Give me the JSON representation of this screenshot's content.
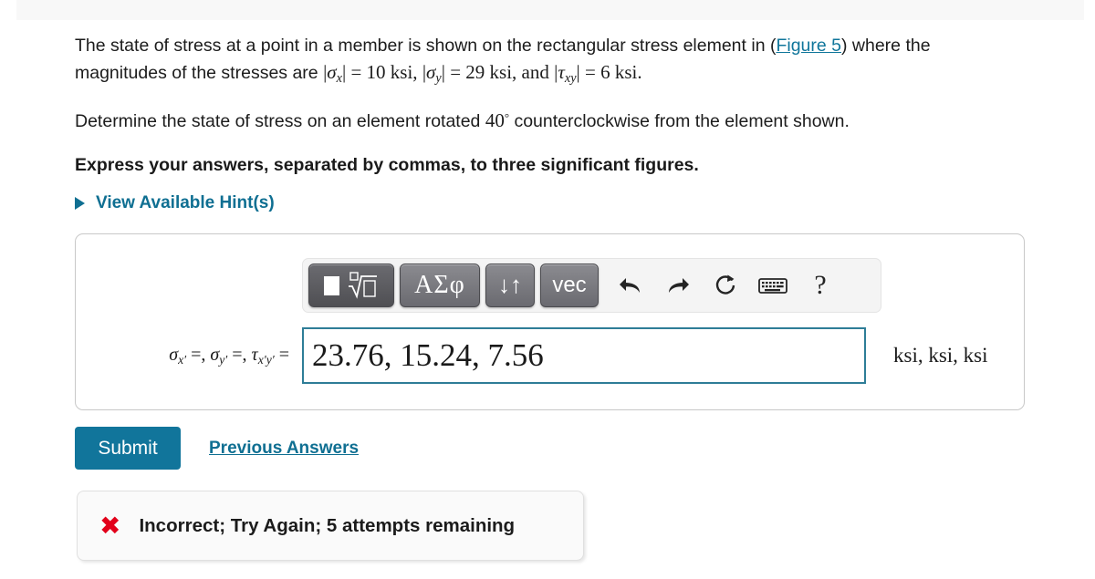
{
  "colors": {
    "link_teal": "#0f6f92",
    "submit_bg": "#11759b",
    "input_border": "#2e7d97",
    "error_red": "#e2001a",
    "panel_border": "#c8c8c8"
  },
  "statement": {
    "line1_a": "The state of stress at a point in a member is shown on the rectangular stress element in (",
    "figure_link": "Figure 5",
    "line1_b": ") where the magnitudes of the stresses are ",
    "sigma_x_sym": "σ",
    "sigma_x_sub": "x",
    "sigma_x_val": "= 10 ksi, ",
    "sigma_y_sym": "σ",
    "sigma_y_sub": "y",
    "sigma_y_val": "= 29 ksi, and ",
    "tau_sym": "τ",
    "tau_sub": "xy",
    "tau_val": "= 6 ksi.",
    "paragraph2_a": "Determine the state of stress on an element rotated ",
    "angle": "40",
    "degree": "°",
    "paragraph2_b": " counterclockwise from the element shown.",
    "instruction": "Express your answers, separated by commas, to three significant figures."
  },
  "hints": {
    "label": "View Available Hint(s)",
    "icon": "triangle-right-icon"
  },
  "toolbar": {
    "buttons": [
      {
        "name": "template-square-root-button",
        "label": "√",
        "kind": "math-template"
      },
      {
        "name": "greek-symbols-button",
        "label": "ΑΣφ",
        "kind": "greek"
      },
      {
        "name": "arrows-updown-button",
        "label": "↓↑",
        "kind": "arrows"
      },
      {
        "name": "vector-button",
        "label": "vec",
        "kind": "vec"
      }
    ],
    "icons": [
      {
        "name": "undo-icon",
        "glyph": "↶"
      },
      {
        "name": "redo-icon",
        "glyph": "↷"
      },
      {
        "name": "reset-icon",
        "glyph": "↻"
      },
      {
        "name": "keyboard-icon",
        "glyph": "⌨"
      },
      {
        "name": "help-icon",
        "glyph": "?"
      }
    ]
  },
  "answer": {
    "label_sigma_x": "σ",
    "label_prime": "′",
    "label_full": "σx′ =, σy′ =, τx′y′ =",
    "value": "23.76, 15.24, 7.56",
    "placeholder": "",
    "units": "ksi, ksi, ksi"
  },
  "actions": {
    "submit_label": "Submit",
    "previous_answers_label": "Previous Answers"
  },
  "feedback": {
    "icon": "x-mark-icon",
    "symbol": "✖",
    "message": "Incorrect; Try Again; 5 attempts remaining"
  }
}
